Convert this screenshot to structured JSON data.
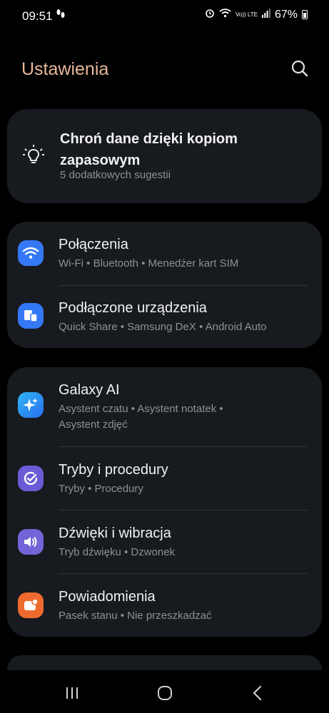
{
  "status_bar": {
    "time": "09:51",
    "lte": "Vo)) LTE",
    "battery": "67%"
  },
  "header": {
    "title": "Ustawienia"
  },
  "backup_card": {
    "title": "Chroń dane dzięki kopiom zapasowym",
    "subtitle": "5 dodatkowych sugestii"
  },
  "settings": [
    {
      "title": "Połączenia",
      "subtitle": "Wi-Fi  •  Bluetooth  •  Menedżer kart SIM",
      "icon": "wifi-icon",
      "color": "#3478f6"
    },
    {
      "title": "Podłączone urządzenia",
      "subtitle": "Quick Share  •  Samsung DeX  •  Android Auto",
      "icon": "devices-icon",
      "color": "#3478f6"
    },
    {
      "title": "Galaxy AI",
      "subtitle": "Asystent czatu  •  Asystent notatek  •",
      "subtitle2": "Asystent zdjęć",
      "icon": "sparkle-icon",
      "color": "#2f8cf5"
    },
    {
      "title": "Tryby i procedury",
      "subtitle": "Tryby  •  Procedury",
      "icon": "check-circle-icon",
      "color": "#6b5bd6"
    },
    {
      "title": "Dźwięki i wibracja",
      "subtitle": "Tryb dźwięku  •  Dzwonek",
      "icon": "speaker-icon",
      "color": "#7165d8"
    },
    {
      "title": "Powiadomienia",
      "subtitle": "Pasek stanu  •  Nie przeszkadzać",
      "icon": "notification-icon",
      "color": "#ef6a2e"
    }
  ]
}
